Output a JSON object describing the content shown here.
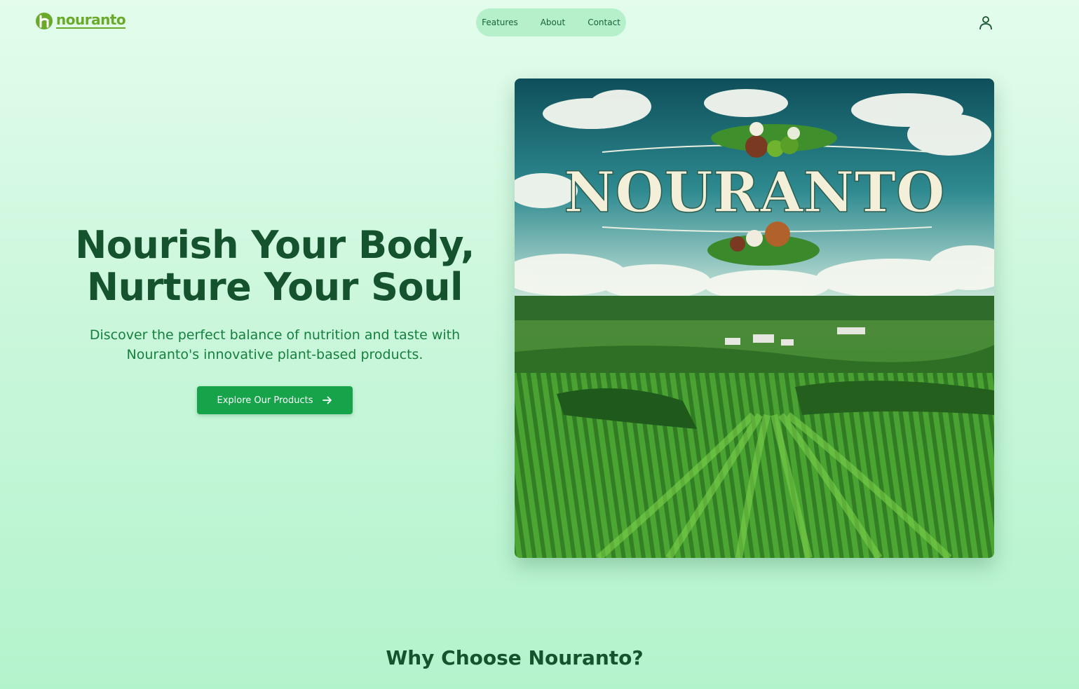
{
  "brand": {
    "name": "nouranto"
  },
  "nav": {
    "items": [
      {
        "label": "Features"
      },
      {
        "label": "About"
      },
      {
        "label": "Contact"
      }
    ]
  },
  "hero": {
    "title": "Nourish Your Body,\nNurture Your Soul",
    "subtitle": "Discover the perfect balance of nutrition and taste with Nouranto's innovative plant-based products.",
    "cta_label": "Explore Our Products",
    "image_text": "NOURANTO"
  },
  "features": {
    "title": "Why Choose Nouranto?"
  },
  "colors": {
    "primary": "#16a34a",
    "heading": "#14532d",
    "text": "#15803d",
    "nav_bg": "#b6f0cb",
    "logo": "#6aaa2a"
  },
  "icons": {
    "user": "user-icon",
    "cta_arrow": "arrow-right-icon",
    "logo": "logo-mark-icon"
  }
}
